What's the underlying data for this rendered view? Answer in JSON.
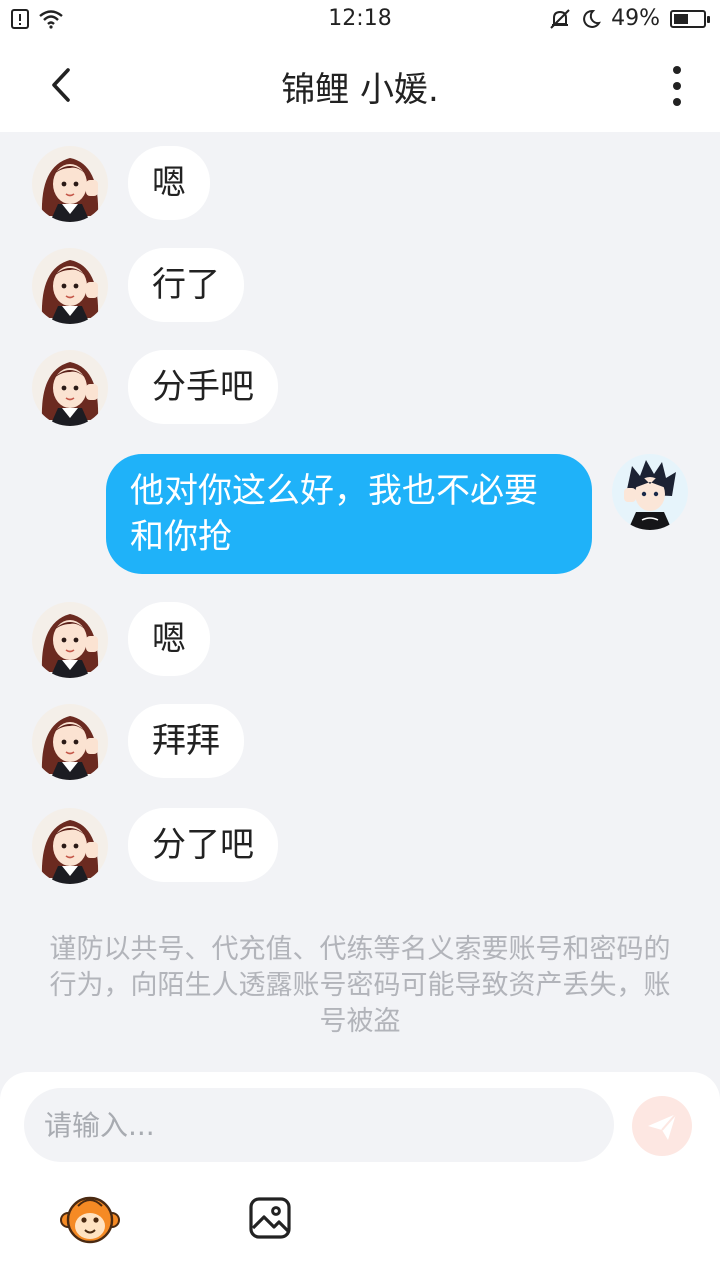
{
  "status_bar": {
    "time": "12:18",
    "battery_text": "49%",
    "battery_level": 0.49,
    "icons": [
      "sim-alert-icon",
      "wifi-icon",
      "mute-bell-icon",
      "moon-icon",
      "battery-icon"
    ]
  },
  "header": {
    "title": "锦鲤 小媛.",
    "back_icon": "chevron-left-icon",
    "more_icon": "more-vertical-icon"
  },
  "messages": [
    {
      "side": "left",
      "text": "嗯"
    },
    {
      "side": "left",
      "text": "行了"
    },
    {
      "side": "left",
      "text": "分手吧"
    },
    {
      "side": "right",
      "text": "他对你这么好，我也不必要和你抢"
    },
    {
      "side": "left",
      "text": "嗯"
    },
    {
      "side": "left",
      "text": "拜拜"
    },
    {
      "side": "left",
      "text": "分了吧"
    }
  ],
  "notice": "谨防以共号、代充值、代练等名义索要账号和密码的行为，向陌生人透露账号密码可能导致资产丢失，账号被盗",
  "composer": {
    "placeholder": "请输入...",
    "send_icon": "paper-plane-icon",
    "emoji_icon": "monkey-face-icon",
    "image_icon": "image-icon"
  },
  "colors": {
    "accent_bubble": "#1fb2f9",
    "background": "#f2f3f6",
    "notice_text": "#b2b4ba",
    "send_disabled": "#fde7e2"
  }
}
